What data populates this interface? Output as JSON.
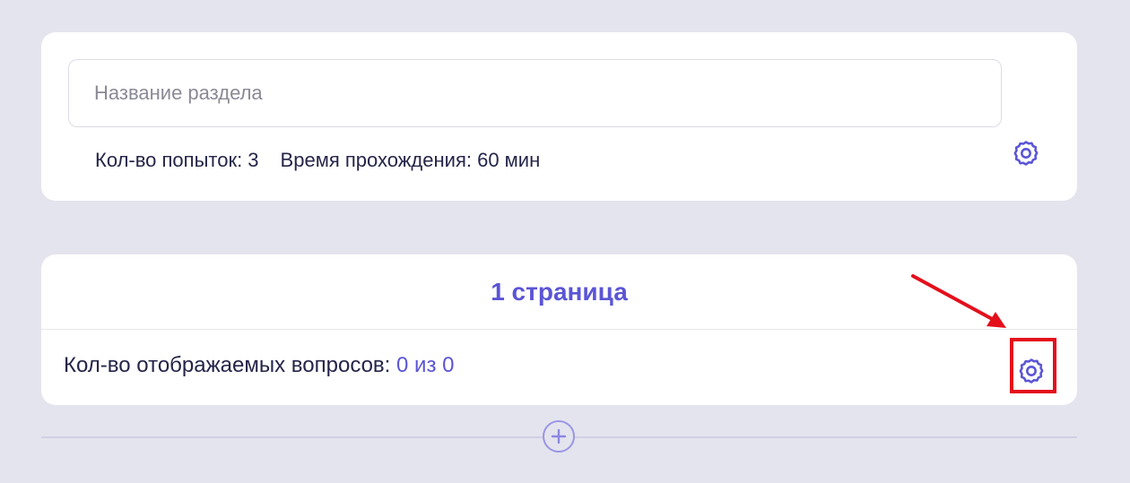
{
  "section": {
    "title_placeholder": "Название раздела",
    "title_value": "",
    "attempts_text": "Кол-во попыток: 3",
    "time_text": "Время прохождения: 60 мин",
    "settings_icon": "gear-icon"
  },
  "page": {
    "title": "1 страница",
    "questions_label": "Кол-во отображаемых вопросов:",
    "questions_value": "0 из 0",
    "settings_icon": "gear-icon"
  },
  "add_button_icon": "plus-circle-icon",
  "colors": {
    "background": "#e4e4ee",
    "accent": "#5b55d6",
    "text": "#25254a",
    "highlight": "#e3101c"
  }
}
